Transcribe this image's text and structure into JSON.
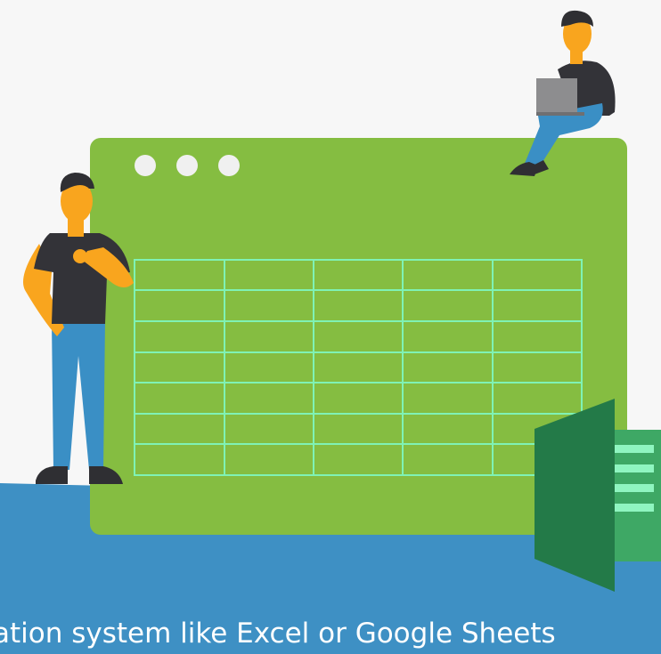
{
  "caption": "ation system like Excel or Google Sheets",
  "colors": {
    "background": "#f7f7f7",
    "floor": "#3e90c4",
    "sheet_panel": "#85bd41",
    "grid_lines": "#7ff2b5",
    "window_dots": "#f0f0f0",
    "excel_dark": "#237a48",
    "excel_light": "#3ea865",
    "excel_stripes": "#8ff5c0",
    "skin": "#f9a51e",
    "hair": "#2f2f33",
    "shirt": "#333338",
    "pants": "#3a8fc5",
    "laptop": "#8d8d8f"
  },
  "icons": [
    "window-dots-icon",
    "excel-logo-icon",
    "laptop-icon"
  ],
  "grid": {
    "rows": 7,
    "columns": 5
  }
}
